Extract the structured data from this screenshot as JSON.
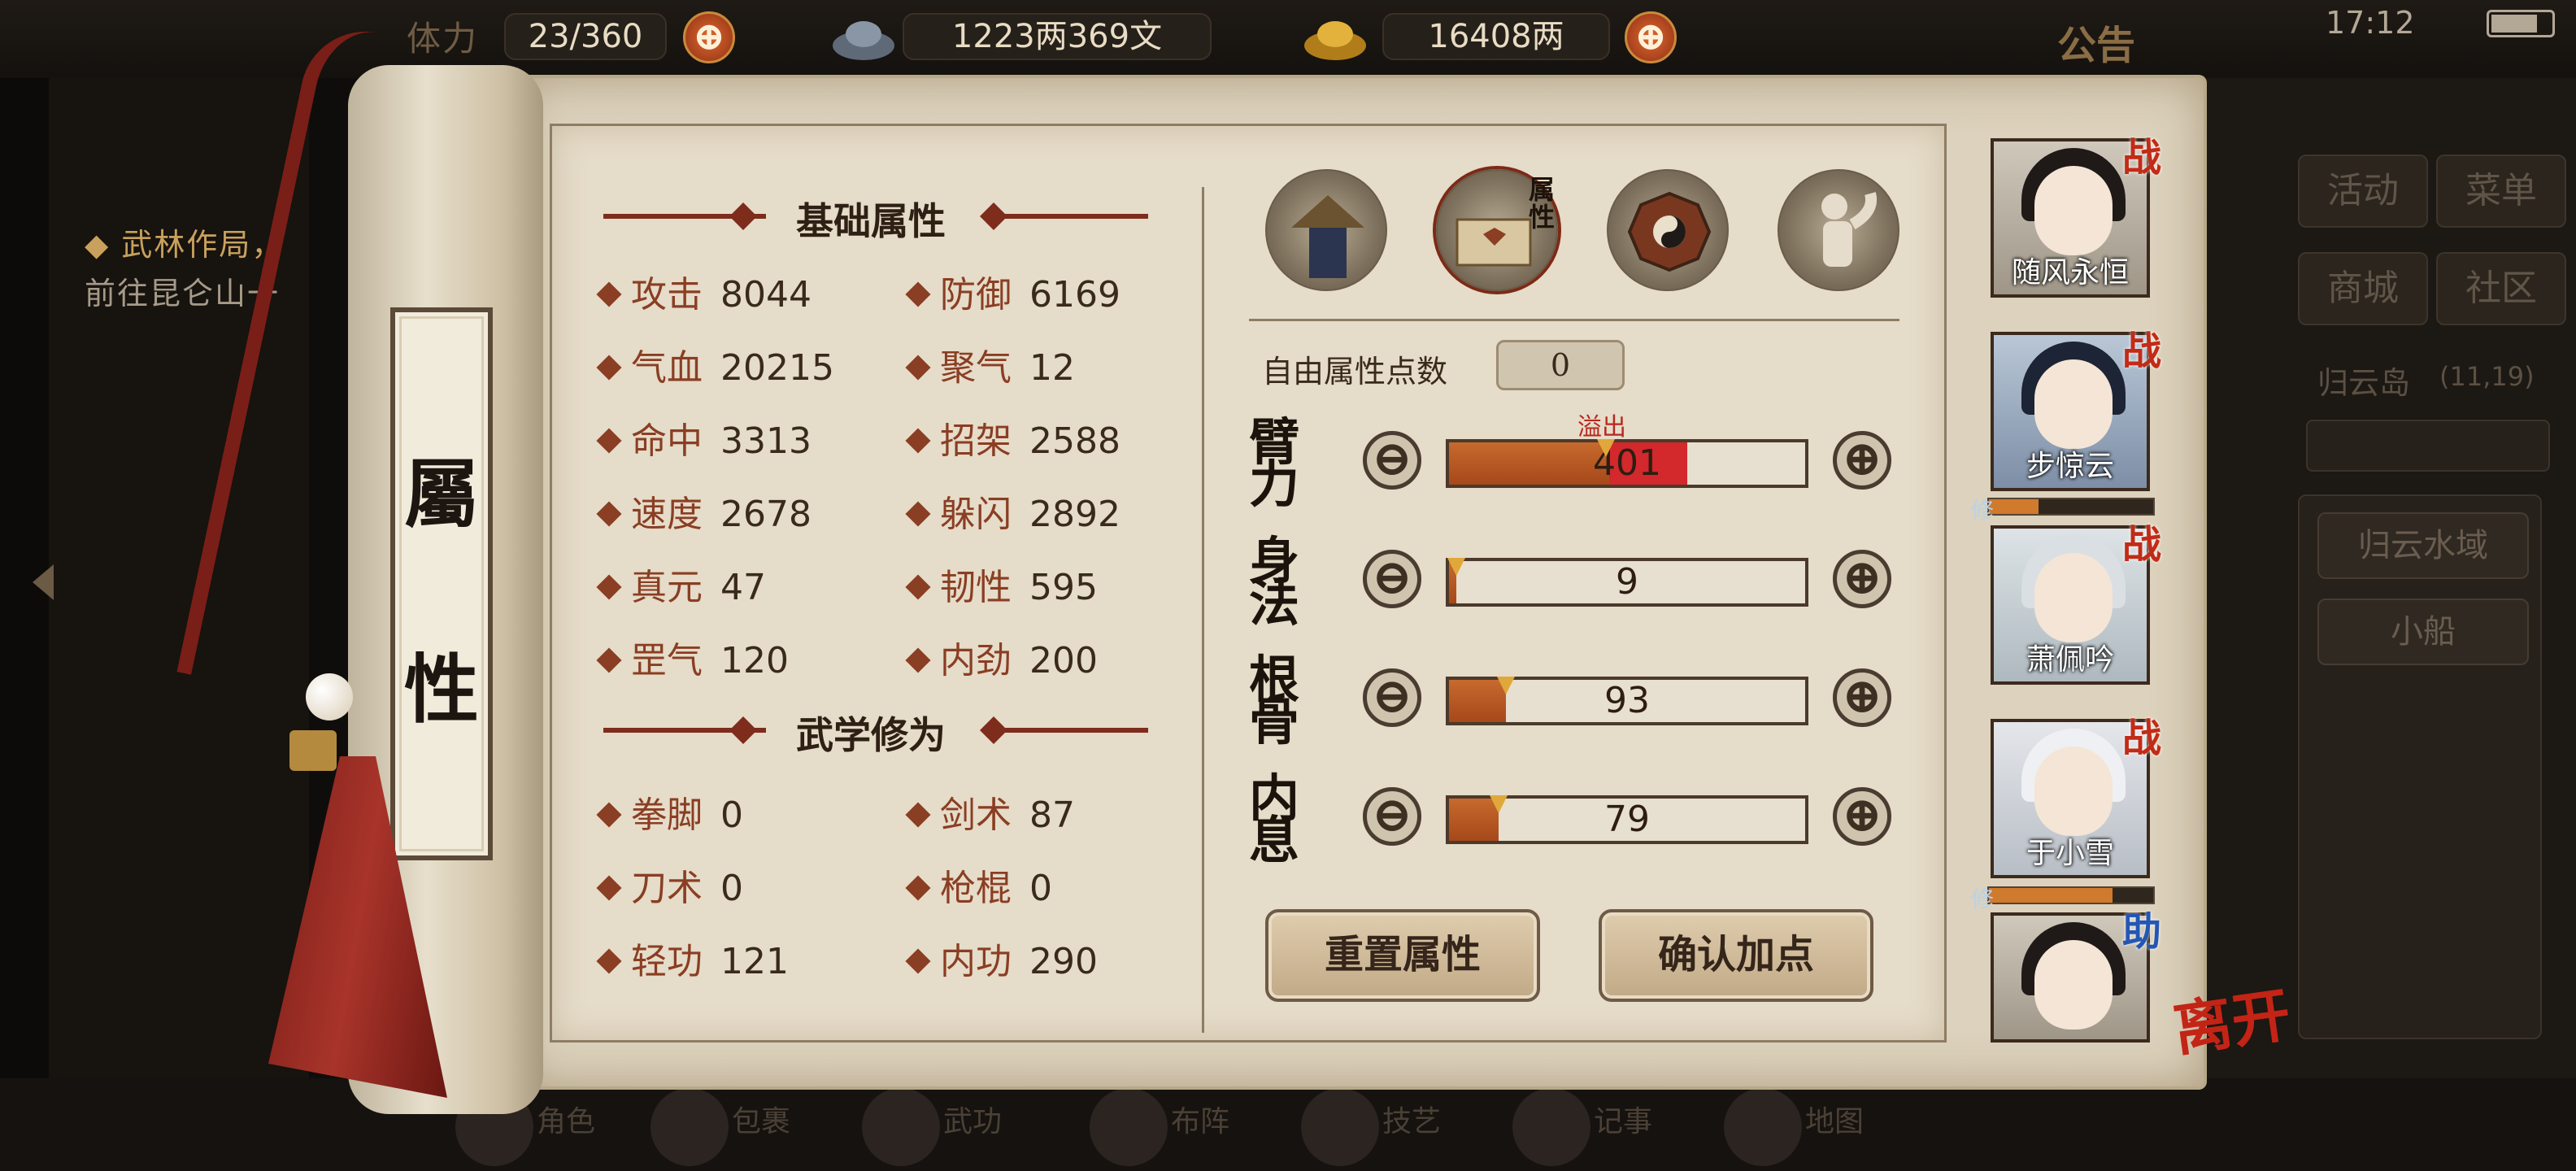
{
  "topbar": {
    "stamina_label": "体力",
    "stamina_value": "23/360",
    "money_value": "1223两369文",
    "gold_value": "16408两",
    "notice_label": "公告",
    "clock": "17:12"
  },
  "quest": {
    "line1": "◆ 武林作局，",
    "line2": "前往昆仑山一"
  },
  "sidebar": {
    "activity": "活动",
    "menu": "菜单",
    "shop": "商城",
    "community": "社区",
    "location": "归云岛",
    "coords": "(11,19)",
    "dest1": "归云水域",
    "dest2": "小船"
  },
  "bottomnav": [
    "角色",
    "包裹",
    "武功",
    "布阵",
    "技艺",
    "记事",
    "地图"
  ],
  "scroll_tag": [
    "屬",
    "性"
  ],
  "basic": {
    "heading": "基础属性",
    "stats": [
      {
        "label": "攻击",
        "value": "8044"
      },
      {
        "label": "防御",
        "value": "6169"
      },
      {
        "label": "气血",
        "value": "20215"
      },
      {
        "label": "聚气",
        "value": "12"
      },
      {
        "label": "命中",
        "value": "3313"
      },
      {
        "label": "招架",
        "value": "2588"
      },
      {
        "label": "速度",
        "value": "2678"
      },
      {
        "label": "躲闪",
        "value": "2892"
      },
      {
        "label": "真元",
        "value": "47"
      },
      {
        "label": "韧性",
        "value": "595"
      },
      {
        "label": "罡气",
        "value": "120"
      },
      {
        "label": "内劲",
        "value": "200"
      }
    ]
  },
  "martial": {
    "heading": "武学修为",
    "stats": [
      {
        "label": "拳脚",
        "value": "0"
      },
      {
        "label": "剑术",
        "value": "87"
      },
      {
        "label": "刀术",
        "value": "0"
      },
      {
        "label": "枪棍",
        "value": "0"
      },
      {
        "label": "轻功",
        "value": "121"
      },
      {
        "label": "内功",
        "value": "290"
      }
    ]
  },
  "tabs": {
    "attribute_tab_label": "属性"
  },
  "free_points": {
    "label": "自由属性点数",
    "value": "0"
  },
  "overflow_label": "溢出",
  "attributes": [
    {
      "name": "臂力",
      "value": "401",
      "fill": 0.45,
      "overflow": 0.22
    },
    {
      "name": "身法",
      "value": "9",
      "fill": 0.02,
      "overflow": 0
    },
    {
      "name": "根骨",
      "value": "93",
      "fill": 0.16,
      "overflow": 0
    },
    {
      "name": "内息",
      "value": "79",
      "fill": 0.14,
      "overflow": 0
    }
  ],
  "buttons": {
    "reset": "重置属性",
    "confirm": "确认加点",
    "minus": "⊖",
    "plus": "⊕"
  },
  "party": [
    {
      "name": "随风永恒",
      "badge": "战"
    },
    {
      "name": "步惊云",
      "badge": "战",
      "exp": 0.3
    },
    {
      "name": "萧佩吟",
      "badge": "战"
    },
    {
      "name": "于小雪",
      "badge": "战",
      "exp": 0.75
    },
    {
      "name": "",
      "badge": "助"
    }
  ],
  "xiu_label": "修",
  "leave_label": "离开",
  "colors": {
    "parchment": "#dcd2bd",
    "accent_red": "#8a3e23",
    "bar_fill": "#c66a2e",
    "bar_overflow": "#d3282c"
  }
}
